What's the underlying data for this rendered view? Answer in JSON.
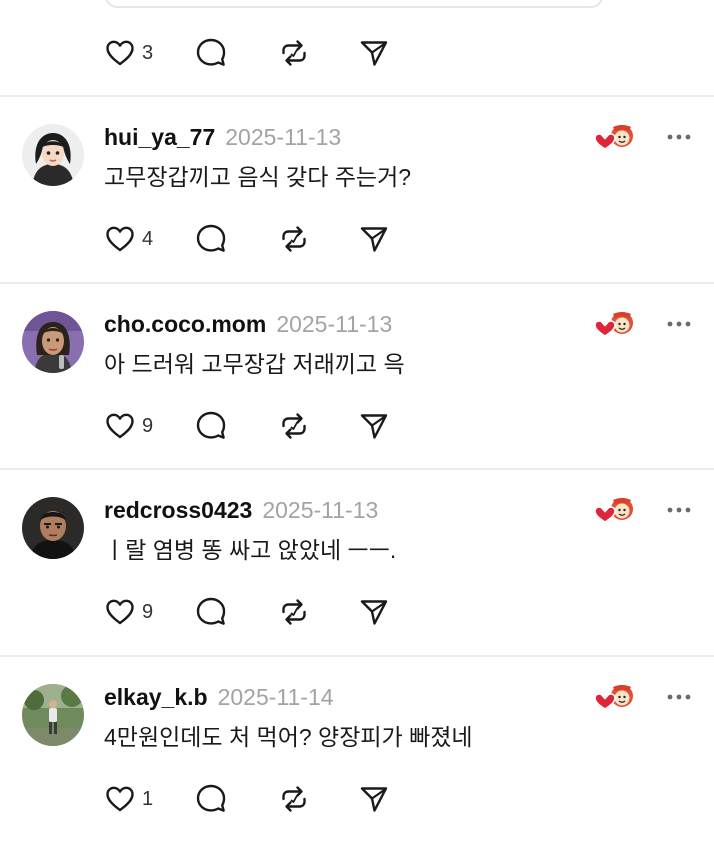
{
  "thread": {
    "top_post": {
      "like_count": "3",
      "icons": [
        "heart-icon",
        "comment-bubble-icon",
        "repost-icon",
        "share-send-icon"
      ]
    },
    "comments": [
      {
        "username": "hui_ya_77",
        "date": "2025-11-13",
        "text": "고무장갑끼고 음식 갖다 주는거?",
        "like_count": "4",
        "avatar": "cartoon-woman-avatar"
      },
      {
        "username": "cho.coco.mom",
        "date": "2025-11-13",
        "text": "아 드러워 고무장갑 저래끼고 윽",
        "like_count": "9",
        "avatar": "woman-photo-avatar"
      },
      {
        "username": "redcross0423",
        "date": "2025-11-13",
        "text": "ㅣ랄 염병 똥 싸고 앉았네 ㅡㅡ.",
        "like_count": "9",
        "avatar": "man-photo-avatar"
      },
      {
        "username": "elkay_k.b",
        "date": "2025-11-14",
        "text": "4만원인데도 처 먹어? 양장피가 빠졌네",
        "like_count": "1",
        "avatar": "outdoor-person-avatar"
      }
    ]
  },
  "colors": {
    "text": "#111111",
    "date": "#a3a3a3",
    "divider": "#ececec",
    "reaction_heart": "#e0243a",
    "icon_stroke": "#1a1a1a"
  }
}
